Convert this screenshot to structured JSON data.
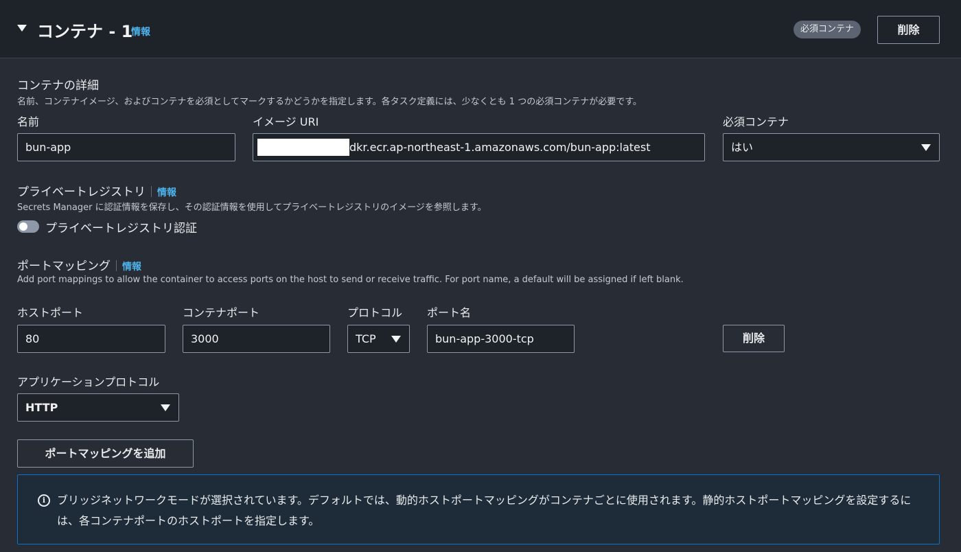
{
  "header": {
    "title": "コンテナ - 1",
    "info_label": "情報",
    "badge": "必須コンテナ",
    "delete_label": "削除"
  },
  "details": {
    "title": "コンテナの詳細",
    "description": "名前、コンテナイメージ、およびコンテナを必須としてマークするかどうかを指定します。各タスク定義には、少なくとも 1 つの必須コンテナが必要です。",
    "name_label": "名前",
    "name_value": "bun-app",
    "image_label": "イメージ URI",
    "image_value": "dkr.ecr.ap-northeast-1.amazonaws.com/bun-app:latest",
    "essential_label": "必須コンテナ",
    "essential_value": "はい"
  },
  "private_registry": {
    "title": "プライベートレジストリ",
    "info_label": "情報",
    "description": "Secrets Manager に認証情報を保存し、その認証情報を使用してプライベートレジストリのイメージを参照します。",
    "toggle_label": "プライベートレジストリ認証"
  },
  "port_mapping": {
    "title": "ポートマッピング",
    "info_label": "情報",
    "description": "Add port mappings to allow the container to access ports on the host to send or receive traffic. For port name, a default will be assigned if left blank.",
    "host_port_label": "ホストポート",
    "host_port_value": "80",
    "container_port_label": "コンテナポート",
    "container_port_value": "3000",
    "protocol_label": "プロトコル",
    "protocol_value": "TCP",
    "port_name_label": "ポート名",
    "port_name_value": "bun-app-3000-tcp",
    "delete_label": "削除",
    "app_protocol_label": "アプリケーションプロトコル",
    "app_protocol_value": "HTTP",
    "add_label": "ポートマッピングを追加"
  },
  "alert": {
    "icon": "info-icon",
    "text": "ブリッジネットワークモードが選択されています。デフォルトでは、動的ホストポートマッピングがコンテナごとに使用されます。静的ホストポートマッピングを設定するには、各コンテナポートのホストポートを指定します。"
  }
}
